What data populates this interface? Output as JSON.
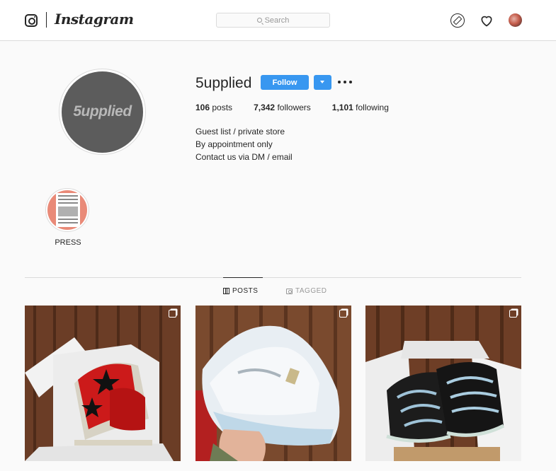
{
  "nav": {
    "brand": "Instagram",
    "search_placeholder": "Search"
  },
  "profile": {
    "username": "5upplied",
    "avatar_text": "5upplied",
    "follow_label": "Follow",
    "stats": [
      {
        "value": "106",
        "label": "posts"
      },
      {
        "value": "7,342",
        "label": "followers"
      },
      {
        "value": "1,101",
        "label": "following"
      }
    ],
    "bio_lines": [
      "Guest list / private store",
      "By appointment only",
      "Contact us via DM / email"
    ]
  },
  "highlights": [
    {
      "label": "PRESS"
    }
  ],
  "tabs": [
    {
      "label": "POSTS",
      "active": true
    },
    {
      "label": "TAGGED",
      "active": false
    }
  ],
  "posts": [
    {
      "subject": "red-star-sneakers-in-box",
      "multi_image": true
    },
    {
      "subject": "white-sneaker-in-hand",
      "multi_image": true
    },
    {
      "subject": "black-skeleton-sneakers-in-box",
      "multi_image": true
    }
  ],
  "colors": {
    "accent": "#3897f0",
    "text": "#262626",
    "muted": "#999999",
    "border": "#dbdbdb",
    "background": "#fafafa"
  }
}
